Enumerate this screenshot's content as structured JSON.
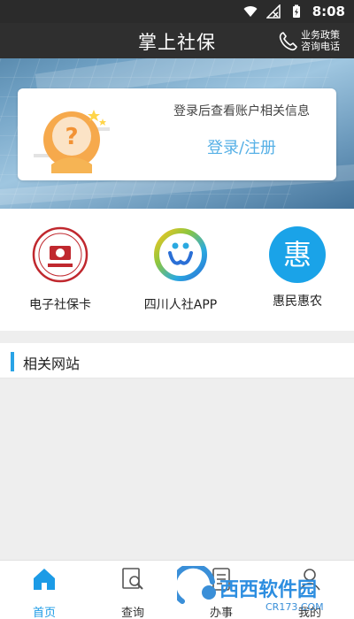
{
  "status_bar": {
    "time": "8:08"
  },
  "header": {
    "title": "掌上社保",
    "hotline_line1": "业务政策",
    "hotline_line2": "咨询电话"
  },
  "login": {
    "hint": "登录后查看账户相关信息",
    "link": "登录/注册"
  },
  "tiles": [
    {
      "label": "电子社保卡",
      "icon": "social-security-card-seal-icon"
    },
    {
      "label": "四川人社APP",
      "icon": "sichuan-hr-app-icon"
    },
    {
      "label": "惠民惠农",
      "icon": "hui-badge-icon",
      "glyph": "惠"
    }
  ],
  "related": {
    "title": "相关网站"
  },
  "bottom_nav": [
    {
      "label": "首页",
      "icon": "home-icon",
      "active": true
    },
    {
      "label": "查询",
      "icon": "search-doc-icon",
      "active": false
    },
    {
      "label": "办事",
      "icon": "service-icon",
      "active": false
    },
    {
      "label": "我的",
      "icon": "profile-icon",
      "active": false
    }
  ],
  "watermark": {
    "text": "西西软件园",
    "subtext": "CR173.COM"
  },
  "colors": {
    "accent": "#1c9be6",
    "link": "#56b0e6",
    "hui_badge": "#1aa3e8",
    "seal_red": "#c0282e"
  }
}
